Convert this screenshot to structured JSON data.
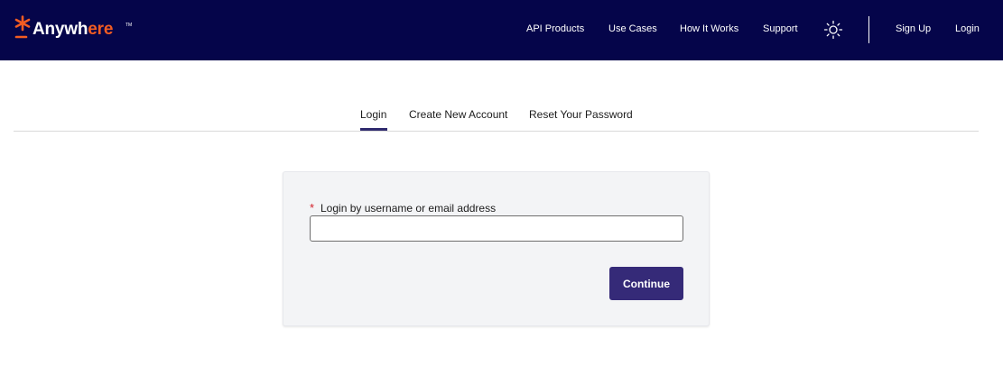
{
  "header": {
    "logo": {
      "brand_main": "Anywh",
      "brand_accent": "ere",
      "trademark": "TM"
    },
    "nav": {
      "api_products": "API Products",
      "use_cases": "Use Cases",
      "how_it_works": "How It Works",
      "support": "Support",
      "theme_toggle_icon": "sun-icon",
      "sign_up": "Sign Up",
      "login": "Login"
    }
  },
  "tabs": {
    "active": "Login",
    "items": [
      "Login",
      "Create New Account",
      "Reset Your Password"
    ]
  },
  "login_form": {
    "required_marker": "*",
    "label": "Login by username or email address",
    "input_value": "",
    "continue_label": "Continue"
  },
  "colors": {
    "header_bg": "#05054a",
    "brand_accent": "#f25c22",
    "primary_button": "#352a78",
    "active_tab_underline": "#2f2a6e",
    "required": "#d3202a",
    "card_bg": "#f3f4f6"
  }
}
